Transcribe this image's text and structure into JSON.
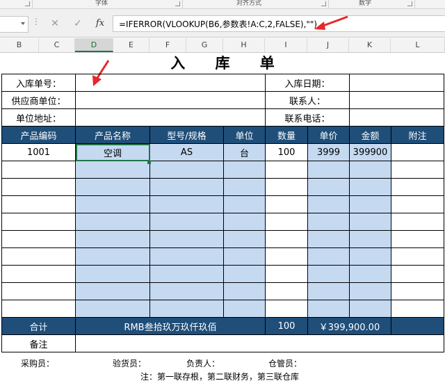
{
  "ribbon": {
    "groups": [
      "字体",
      "对齐方式",
      "数字"
    ]
  },
  "formula_bar": {
    "cancel_icon": "✕",
    "enter_icon": "✓",
    "fx_label": "fx",
    "formula": "=IFERROR(VLOOKUP(B6,参数表!A:C,2,FALSE),\"\")"
  },
  "columns": [
    "B",
    "C",
    "D",
    "E",
    "F",
    "G",
    "H",
    "I",
    "J",
    "K",
    "L"
  ],
  "sheet": {
    "title": "入 库 单",
    "info": {
      "order_no_label": "入库单号：",
      "date_label": "入库日期：",
      "supplier_label": "供应商单位：",
      "contact_label": "联系人：",
      "address_label": "单位地址：",
      "phone_label": "联系电话："
    },
    "headers": [
      "产品编码",
      "产品名称",
      "型号/规格",
      "单位",
      "数量",
      "单价",
      "金额",
      "附注"
    ],
    "row1": {
      "code": "1001",
      "name": "空调",
      "model": "AS",
      "unit": "台",
      "qty": "100",
      "price": "3999",
      "amount": "399900",
      "note": ""
    },
    "total": {
      "label": "合计",
      "amount_words": "RMB叁拾玖万玖仟玖佰",
      "qty": "100",
      "amount": "￥399,900.00"
    },
    "remark_label": "备注"
  },
  "footer": {
    "buyer": "采购员：",
    "inspector": "验货员：",
    "manager": "负责人：",
    "keeper": "仓管员：",
    "note": "注：第一联存根，第二联财务，第三联仓库"
  },
  "colors": {
    "header_blue": "#1f4e79",
    "cell_blue": "#c5d9f1",
    "arrow_red": "#e8262b",
    "excel_green": "#217346"
  }
}
